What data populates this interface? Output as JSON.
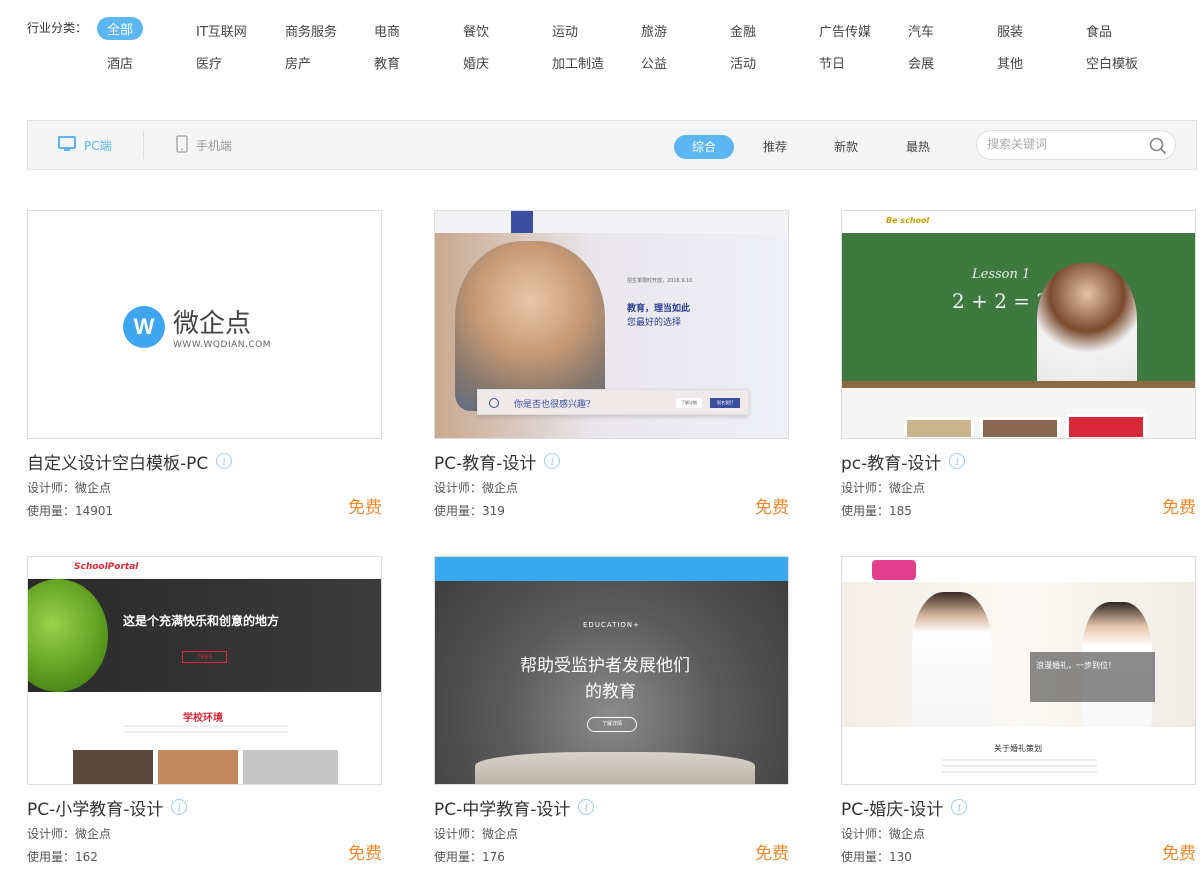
{
  "categories": {
    "label": "行业分类：",
    "row1": [
      "全部",
      "IT互联网",
      "商务服务",
      "电商",
      "餐饮",
      "运动",
      "旅游",
      "金融",
      "广告传媒",
      "汽车",
      "服装",
      "食品"
    ],
    "row2": [
      "酒店",
      "医疗",
      "房产",
      "教育",
      "婚庆",
      "加工制造",
      "公益",
      "活动",
      "节日",
      "会展",
      "其他",
      "空白模板"
    ],
    "active": "全部"
  },
  "toolbar": {
    "device_pc": "PC端",
    "device_mobile": "手机端",
    "sort": [
      "综合",
      "推荐",
      "新款",
      "最热"
    ],
    "search_placeholder": "搜索关键词"
  },
  "labels": {
    "designer_prefix": "设计师：",
    "usage_prefix": "使用量：",
    "info_glyph": "i"
  },
  "templates": [
    {
      "title": "自定义设计空白模板-PC",
      "designer": "微企点",
      "usage": "14901",
      "price": "免费",
      "thumb": {
        "logo_text": "微企点",
        "logo_url": "WWW.WQDIAN.COM"
      }
    },
    {
      "title": "PC-教育-设计",
      "designer": "微企点",
      "usage": "319",
      "price": "免费",
      "thumb": {
        "date": "招生季限时开放，2016.9.10",
        "headline": "教育，理当如此",
        "subline": "您最好的选择",
        "question": "你是否也很感兴趣？",
        "btn1": "了解详细",
        "btn2": "报名我们"
      }
    },
    {
      "title": "pc-教育-设计",
      "designer": "微企点",
      "usage": "185",
      "price": "免费",
      "thumb": {
        "brand": "Be school",
        "lesson": "Lesson 1",
        "equation": "2 + 2 = ?"
      }
    },
    {
      "title": "PC-小学教育-设计",
      "designer": "微企点",
      "usage": "162",
      "price": "免费",
      "thumb": {
        "brand": "SchoolPortal",
        "headline": "这是个充满快乐和创意的地方",
        "section": "学校环境",
        "btn": "了解更多"
      }
    },
    {
      "title": "PC-中学教育-设计",
      "designer": "微企点",
      "usage": "176",
      "price": "免费",
      "thumb": {
        "brand": "EDUCATION+",
        "line1": "帮助受监护者发展他们",
        "line2": "的教育",
        "btn": "了解详情"
      }
    },
    {
      "title": "PC-婚庆-设计",
      "designer": "微企点",
      "usage": "130",
      "price": "免费",
      "thumb": {
        "banner": "浪漫婚礼，一步到位！",
        "section": "关于婚礼策划"
      }
    }
  ]
}
